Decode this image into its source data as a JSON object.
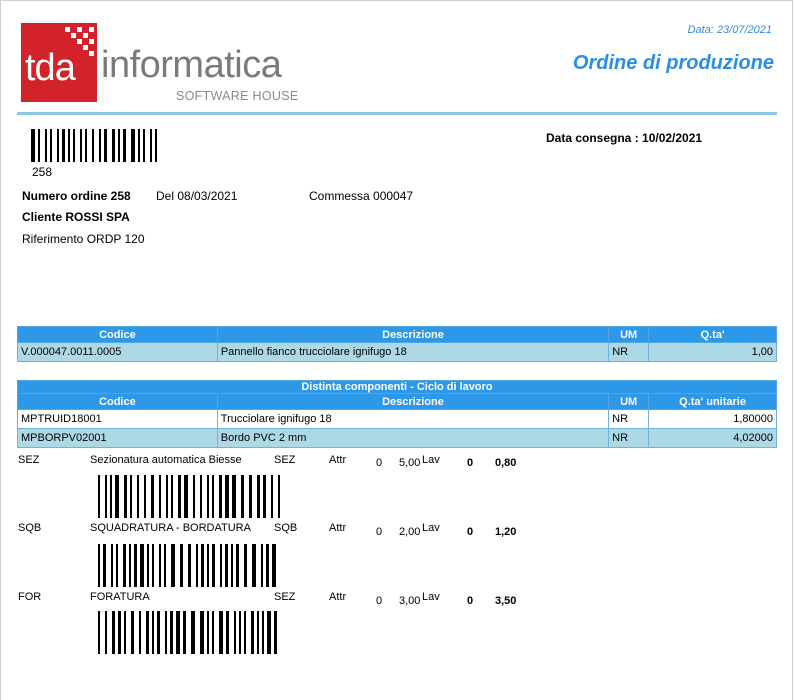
{
  "header": {
    "logo_mark": "tda",
    "logo_word": "informatica",
    "logo_tagline": "SOFTWARE HOUSE",
    "print_date": "Data: 23/07/2021",
    "title": "Ordine di produzione",
    "accent_color": "#2b8ee4",
    "logo_color": "#d3232a"
  },
  "order": {
    "barcode_value": "258",
    "delivery": "Data consegna : 10/02/2021",
    "number": "Numero ordine 258",
    "date": "Del 08/03/2021",
    "commessa": "Commessa 000047",
    "cliente": "Cliente ROSSI SPA",
    "riferimento": "Riferimento ORDP 120"
  },
  "product_table": {
    "headers": [
      "Codice",
      "Descrizione",
      "UM",
      "Q.ta'"
    ],
    "rows": [
      [
        "V.000047.0011.0005",
        "Pannello fianco trucciolare ignifugo 18",
        "NR",
        "1,00"
      ]
    ]
  },
  "components_table": {
    "band": "Distinta componenti - Ciclo di lavoro",
    "headers": [
      "Codice",
      "Descrizione",
      "UM",
      "Q.ta' unitarie"
    ],
    "rows": [
      [
        "MPTRUID18001",
        "Trucciolare ignifugo 18",
        "NR",
        "1,80000"
      ],
      [
        "MPBORPV02001",
        "Bordo PVC 2 mm",
        "NR",
        "4,02000"
      ]
    ]
  },
  "operations": [
    {
      "code": "SEZ",
      "desc": "Sezionatura automatica Biesse",
      "machine": "SEZ",
      "attr": "Attr",
      "a": "0",
      "t": "5,00",
      "lav": "Lav",
      "b": "0",
      "qty": "0,80"
    },
    {
      "code": "SQB",
      "desc": "SQUADRATURA - BORDATURA",
      "machine": "SQB",
      "attr": "Attr",
      "a": "0",
      "t": "2,00",
      "lav": "Lav",
      "b": "0",
      "qty": "1,20"
    },
    {
      "code": "FOR",
      "desc": "FORATURA",
      "machine": "SEZ",
      "attr": "Attr",
      "a": "0",
      "t": "3,00",
      "lav": "Lav",
      "b": "0",
      "qty": "3,50"
    }
  ]
}
